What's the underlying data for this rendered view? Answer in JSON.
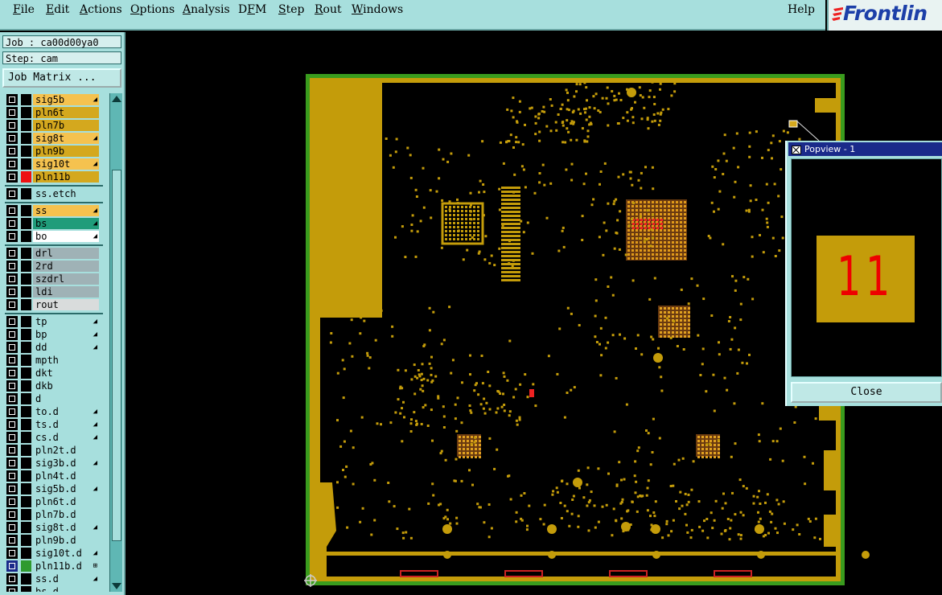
{
  "menubar": {
    "items": [
      {
        "pre": "",
        "ul": "F",
        "post": "ile"
      },
      {
        "pre": "",
        "ul": "E",
        "post": "dit"
      },
      {
        "pre": "",
        "ul": "A",
        "post": "ctions"
      },
      {
        "pre": "",
        "ul": "O",
        "post": "ptions"
      },
      {
        "pre": "",
        "ul": "A",
        "post": "nalysis"
      },
      {
        "pre": "D",
        "ul": "F",
        "post": "M"
      },
      {
        "pre": "",
        "ul": "S",
        "post": "tep"
      },
      {
        "pre": "",
        "ul": "R",
        "post": "out"
      },
      {
        "pre": "",
        "ul": "W",
        "post": "indows"
      }
    ],
    "help": "Help"
  },
  "logo": {
    "text": "Frontlin"
  },
  "panel": {
    "job": "Job : ca00d00ya0",
    "step": "Step: cam",
    "job_matrix_button": "Job Matrix ..."
  },
  "layers": [
    {
      "name": "sig5b",
      "color": "#f5c24f",
      "mark": "◢",
      "checkbox": "black"
    },
    {
      "name": "pln6t",
      "color": "#d4a81e",
      "mark": "",
      "checkbox": "black"
    },
    {
      "name": "pln7b",
      "color": "#d4a81e",
      "mark": "",
      "checkbox": "black"
    },
    {
      "name": "sig8t",
      "color": "#f5c24f",
      "mark": "◢",
      "checkbox": "black"
    },
    {
      "name": "pln9b",
      "color": "#d4a81e",
      "mark": "",
      "checkbox": "black"
    },
    {
      "name": "sig10t",
      "color": "#f5c24f",
      "mark": "◢",
      "checkbox": "black"
    },
    {
      "name": "pln11b",
      "color": "#d4a81e",
      "mark": "",
      "checkbox": "black",
      "swatch": "#ee1111"
    },
    {
      "name": "ss.etch",
      "color": "#a7dfdd",
      "mark": "",
      "checkbox": "black",
      "sep_before": true
    },
    {
      "name": "ss",
      "color": "#f5c24f",
      "mark": "◢",
      "checkbox": "black",
      "sep_before": true
    },
    {
      "name": "bs",
      "color": "#1f9c7a",
      "mark": "◢",
      "checkbox": "black"
    },
    {
      "name": "bo",
      "color": "#ffffff",
      "mark": "◢",
      "checkbox": "black"
    },
    {
      "name": "drl",
      "color": "#9fb2b6",
      "mark": "",
      "checkbox": "black",
      "sep_before": true
    },
    {
      "name": "2rd",
      "color": "#9fb2b6",
      "mark": "",
      "checkbox": "black"
    },
    {
      "name": "szdrl",
      "color": "#9fb2b6",
      "mark": "",
      "checkbox": "black"
    },
    {
      "name": "ldi",
      "color": "#9fb2b6",
      "mark": "",
      "checkbox": "black"
    },
    {
      "name": "rout",
      "color": "#d9dcdc",
      "mark": "",
      "checkbox": "black"
    },
    {
      "name": "tp",
      "color": "#a7dfdd",
      "mark": "◢",
      "checkbox": "black",
      "sep_before": true
    },
    {
      "name": "bp",
      "color": "#a7dfdd",
      "mark": "◢",
      "checkbox": "black"
    },
    {
      "name": "dd",
      "color": "#a7dfdd",
      "mark": "◢",
      "checkbox": "black"
    },
    {
      "name": "mpth",
      "color": "#a7dfdd",
      "mark": "",
      "checkbox": "black"
    },
    {
      "name": "dkt",
      "color": "#a7dfdd",
      "mark": "",
      "checkbox": "black"
    },
    {
      "name": "dkb",
      "color": "#a7dfdd",
      "mark": "",
      "checkbox": "black"
    },
    {
      "name": "d",
      "color": "#a7dfdd",
      "mark": "",
      "checkbox": "black"
    },
    {
      "name": "to.d",
      "color": "#a7dfdd",
      "mark": "◢",
      "checkbox": "black"
    },
    {
      "name": "ts.d",
      "color": "#a7dfdd",
      "mark": "◢",
      "checkbox": "black"
    },
    {
      "name": "cs.d",
      "color": "#a7dfdd",
      "mark": "◢",
      "checkbox": "black"
    },
    {
      "name": "pln2t.d",
      "color": "#a7dfdd",
      "mark": "",
      "checkbox": "black"
    },
    {
      "name": "sig3b.d",
      "color": "#a7dfdd",
      "mark": "◢",
      "checkbox": "black"
    },
    {
      "name": "pln4t.d",
      "color": "#a7dfdd",
      "mark": "",
      "checkbox": "black"
    },
    {
      "name": "sig5b.d",
      "color": "#a7dfdd",
      "mark": "◢",
      "checkbox": "black"
    },
    {
      "name": "pln6t.d",
      "color": "#a7dfdd",
      "mark": "",
      "checkbox": "black"
    },
    {
      "name": "pln7b.d",
      "color": "#a7dfdd",
      "mark": "",
      "checkbox": "black"
    },
    {
      "name": "sig8t.d",
      "color": "#a7dfdd",
      "mark": "◢",
      "checkbox": "black"
    },
    {
      "name": "pln9b.d",
      "color": "#a7dfdd",
      "mark": "",
      "checkbox": "black"
    },
    {
      "name": "sig10t.d",
      "color": "#a7dfdd",
      "mark": "◢",
      "checkbox": "black"
    },
    {
      "name": "pln11b.d",
      "color": "#a7dfdd",
      "mark": "⊞",
      "checkbox": "blue",
      "swatch": "#2f9a2f"
    },
    {
      "name": "ss.d",
      "color": "#a7dfdd",
      "mark": "◢",
      "checkbox": "black"
    },
    {
      "name": "bs.d",
      "color": "#a7dfdd",
      "mark": "",
      "checkbox": "black"
    }
  ],
  "popview": {
    "title": "Popview - 1",
    "pad_text": "11",
    "close_label": "Close"
  },
  "colors": {
    "board_copper": "#c49c0a",
    "board_outline": "#3a9c1e",
    "highlight": "#ee2222",
    "background": "#000000"
  }
}
